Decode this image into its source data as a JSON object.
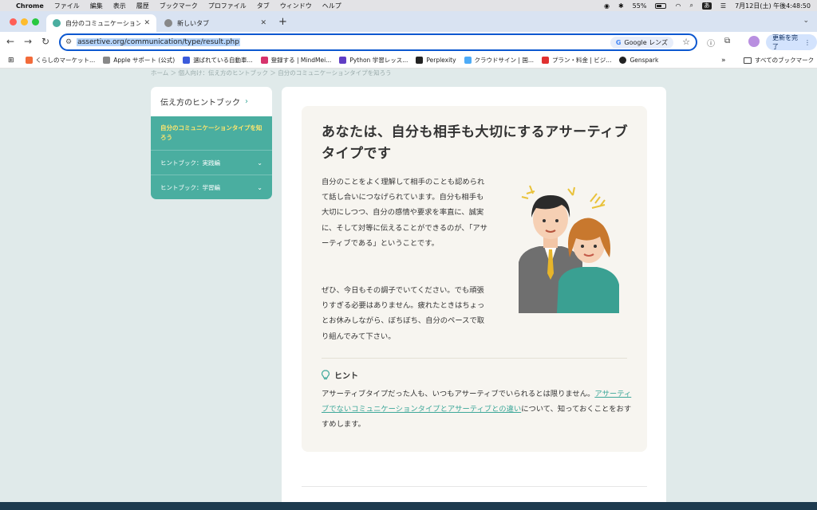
{
  "menubar": {
    "app": "Chrome",
    "items": [
      "ファイル",
      "編集",
      "表示",
      "履歴",
      "ブックマーク",
      "プロファイル",
      "タブ",
      "ウィンドウ",
      "ヘルプ"
    ],
    "battery": "55%",
    "ime": "あ",
    "datetime": "7月12日(土) 午後4:48:50"
  },
  "tabs": [
    {
      "title": "自分のコミュニケーションタイプ",
      "active": true
    },
    {
      "title": "新しいタブ",
      "active": false
    }
  ],
  "toolbar": {
    "url": "assertive.org/communication/type/result.php",
    "lens_label": "Google レンズ",
    "update_label": "更新を完了"
  },
  "bookmarks": [
    {
      "label": "くらしのマーケット...",
      "color": "#f26b3a"
    },
    {
      "label": "Apple サポート (公式)",
      "color": "#888888"
    },
    {
      "label": "選ばれている自動車...",
      "color": "#3b5bdb"
    },
    {
      "label": "登録する | MindMei...",
      "color": "#d6336c"
    },
    {
      "label": "Python 学習レッス...",
      "color": "#5f3dc4"
    },
    {
      "label": "Perplexity",
      "color": "#222222"
    },
    {
      "label": "クラウドサイン | 国...",
      "color": "#4dabf7"
    },
    {
      "label": "プラン・料金 | ビジ...",
      "color": "#e03131"
    },
    {
      "label": "Genspark",
      "color": "#222222"
    }
  ],
  "bookmarks_all": "すべてのブックマーク",
  "breadcrumb": "ホーム ＞ 個人向け：伝え方のヒントブック ＞ 自分のコミュニケーションタイプを知ろう",
  "sidebar": {
    "header": "伝え方のヒントブック",
    "current": "自分のコミュニケーションタイプを知ろう",
    "items": [
      "ヒントブック：実践編",
      "ヒントブック：学習編"
    ]
  },
  "result": {
    "title": "あなたは、自分も相手も大切にするアサーティブタイプです",
    "para1": "自分のことをよく理解して相手のことも認められて話し合いにつなげられています。自分も相手も大切にしつつ、自分の感情や要求を率直に、誠実に、そして対等に伝えることができるのが、「アサーティブである」ということです。",
    "para2": "ぜひ、今日もその調子でいてください。でも頑張りすぎる必要はありません。疲れたときはちょっとお休みしながら、ぼちぼち、自分のペースで取り組んでみて下さい。",
    "hint_title": "ヒント",
    "hint_before": "アサーティブタイプだった人も、いつもアサーティブでいられるとは限りません。",
    "hint_link": "アサーティブでないコミュニケーションタイプとアサーティブとの違い",
    "hint_after": "について、知っておくことをおすすめします。"
  },
  "colors": {
    "accent": "#4aaea0",
    "current_item": "#ffe66d",
    "page_bg": "#e0eaea",
    "card_bg": "#f7f5f0"
  }
}
